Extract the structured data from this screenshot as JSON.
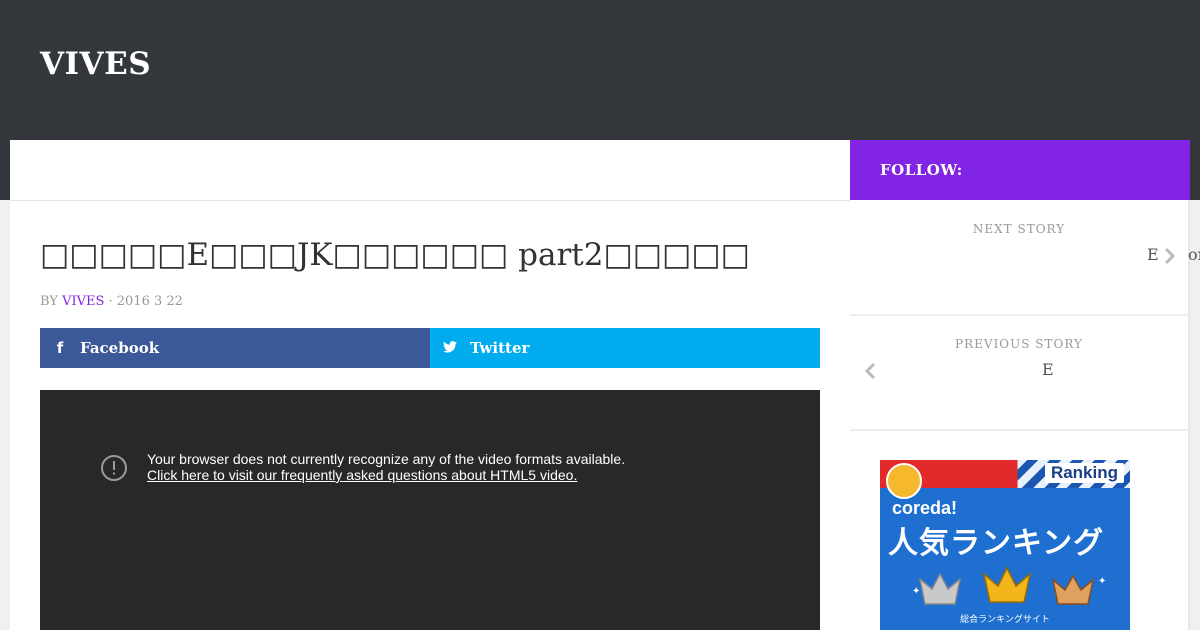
{
  "site": {
    "title": "VIVES"
  },
  "follow": {
    "label": "FOLLOW:"
  },
  "post": {
    "title": "□□□□□E□□□JK□□□□□□ part2□□□□□",
    "byline_prefix": "BY",
    "author": "VIVES",
    "date": "· 2016   3   22"
  },
  "share": {
    "facebook_label": "Facebook",
    "twitter_label": "Twitter"
  },
  "video": {
    "message": "Your browser does not currently recognize any of the video formats available.",
    "link": "Click here to visit our frequently asked questions about HTML5 video."
  },
  "sidebar": {
    "next": {
      "label": "NEXT STORY",
      "title": "E",
      "title_tail": "or"
    },
    "previous": {
      "label": "PREVIOUS STORY",
      "title": "E"
    },
    "ad": {
      "ranking": "Ranking",
      "brand": "coreda!",
      "headline": "人気ランキング",
      "footer": "総合ランキングサイト"
    }
  },
  "colors": {
    "accent": "#8224e3",
    "header": "#33363b",
    "facebook": "#3b5998",
    "twitter": "#00acee"
  }
}
